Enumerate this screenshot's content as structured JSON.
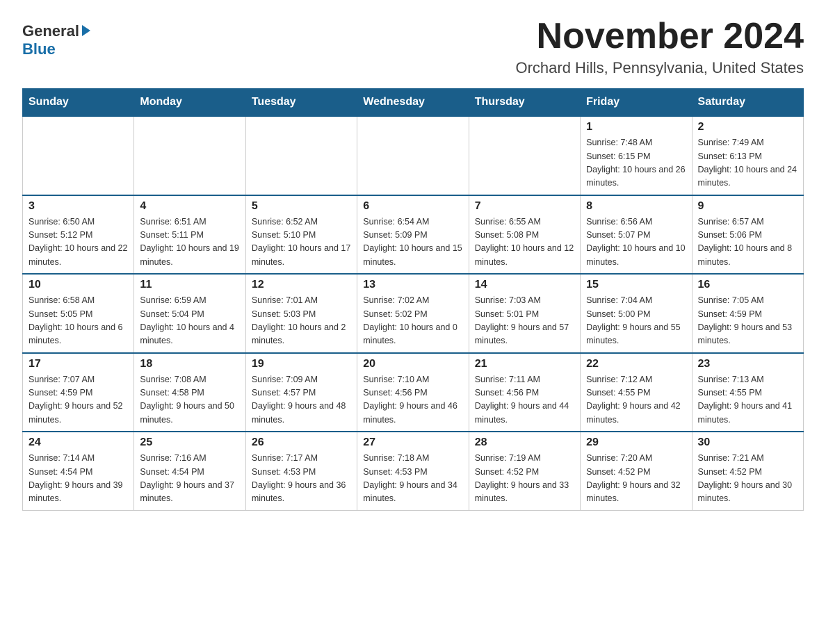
{
  "logo": {
    "general": "General",
    "blue": "Blue"
  },
  "header": {
    "month": "November 2024",
    "location": "Orchard Hills, Pennsylvania, United States"
  },
  "weekdays": [
    "Sunday",
    "Monday",
    "Tuesday",
    "Wednesday",
    "Thursday",
    "Friday",
    "Saturday"
  ],
  "weeks": [
    [
      {
        "day": "",
        "info": ""
      },
      {
        "day": "",
        "info": ""
      },
      {
        "day": "",
        "info": ""
      },
      {
        "day": "",
        "info": ""
      },
      {
        "day": "",
        "info": ""
      },
      {
        "day": "1",
        "info": "Sunrise: 7:48 AM\nSunset: 6:15 PM\nDaylight: 10 hours and 26 minutes."
      },
      {
        "day": "2",
        "info": "Sunrise: 7:49 AM\nSunset: 6:13 PM\nDaylight: 10 hours and 24 minutes."
      }
    ],
    [
      {
        "day": "3",
        "info": "Sunrise: 6:50 AM\nSunset: 5:12 PM\nDaylight: 10 hours and 22 minutes."
      },
      {
        "day": "4",
        "info": "Sunrise: 6:51 AM\nSunset: 5:11 PM\nDaylight: 10 hours and 19 minutes."
      },
      {
        "day": "5",
        "info": "Sunrise: 6:52 AM\nSunset: 5:10 PM\nDaylight: 10 hours and 17 minutes."
      },
      {
        "day": "6",
        "info": "Sunrise: 6:54 AM\nSunset: 5:09 PM\nDaylight: 10 hours and 15 minutes."
      },
      {
        "day": "7",
        "info": "Sunrise: 6:55 AM\nSunset: 5:08 PM\nDaylight: 10 hours and 12 minutes."
      },
      {
        "day": "8",
        "info": "Sunrise: 6:56 AM\nSunset: 5:07 PM\nDaylight: 10 hours and 10 minutes."
      },
      {
        "day": "9",
        "info": "Sunrise: 6:57 AM\nSunset: 5:06 PM\nDaylight: 10 hours and 8 minutes."
      }
    ],
    [
      {
        "day": "10",
        "info": "Sunrise: 6:58 AM\nSunset: 5:05 PM\nDaylight: 10 hours and 6 minutes."
      },
      {
        "day": "11",
        "info": "Sunrise: 6:59 AM\nSunset: 5:04 PM\nDaylight: 10 hours and 4 minutes."
      },
      {
        "day": "12",
        "info": "Sunrise: 7:01 AM\nSunset: 5:03 PM\nDaylight: 10 hours and 2 minutes."
      },
      {
        "day": "13",
        "info": "Sunrise: 7:02 AM\nSunset: 5:02 PM\nDaylight: 10 hours and 0 minutes."
      },
      {
        "day": "14",
        "info": "Sunrise: 7:03 AM\nSunset: 5:01 PM\nDaylight: 9 hours and 57 minutes."
      },
      {
        "day": "15",
        "info": "Sunrise: 7:04 AM\nSunset: 5:00 PM\nDaylight: 9 hours and 55 minutes."
      },
      {
        "day": "16",
        "info": "Sunrise: 7:05 AM\nSunset: 4:59 PM\nDaylight: 9 hours and 53 minutes."
      }
    ],
    [
      {
        "day": "17",
        "info": "Sunrise: 7:07 AM\nSunset: 4:59 PM\nDaylight: 9 hours and 52 minutes."
      },
      {
        "day": "18",
        "info": "Sunrise: 7:08 AM\nSunset: 4:58 PM\nDaylight: 9 hours and 50 minutes."
      },
      {
        "day": "19",
        "info": "Sunrise: 7:09 AM\nSunset: 4:57 PM\nDaylight: 9 hours and 48 minutes."
      },
      {
        "day": "20",
        "info": "Sunrise: 7:10 AM\nSunset: 4:56 PM\nDaylight: 9 hours and 46 minutes."
      },
      {
        "day": "21",
        "info": "Sunrise: 7:11 AM\nSunset: 4:56 PM\nDaylight: 9 hours and 44 minutes."
      },
      {
        "day": "22",
        "info": "Sunrise: 7:12 AM\nSunset: 4:55 PM\nDaylight: 9 hours and 42 minutes."
      },
      {
        "day": "23",
        "info": "Sunrise: 7:13 AM\nSunset: 4:55 PM\nDaylight: 9 hours and 41 minutes."
      }
    ],
    [
      {
        "day": "24",
        "info": "Sunrise: 7:14 AM\nSunset: 4:54 PM\nDaylight: 9 hours and 39 minutes."
      },
      {
        "day": "25",
        "info": "Sunrise: 7:16 AM\nSunset: 4:54 PM\nDaylight: 9 hours and 37 minutes."
      },
      {
        "day": "26",
        "info": "Sunrise: 7:17 AM\nSunset: 4:53 PM\nDaylight: 9 hours and 36 minutes."
      },
      {
        "day": "27",
        "info": "Sunrise: 7:18 AM\nSunset: 4:53 PM\nDaylight: 9 hours and 34 minutes."
      },
      {
        "day": "28",
        "info": "Sunrise: 7:19 AM\nSunset: 4:52 PM\nDaylight: 9 hours and 33 minutes."
      },
      {
        "day": "29",
        "info": "Sunrise: 7:20 AM\nSunset: 4:52 PM\nDaylight: 9 hours and 32 minutes."
      },
      {
        "day": "30",
        "info": "Sunrise: 7:21 AM\nSunset: 4:52 PM\nDaylight: 9 hours and 30 minutes."
      }
    ]
  ]
}
